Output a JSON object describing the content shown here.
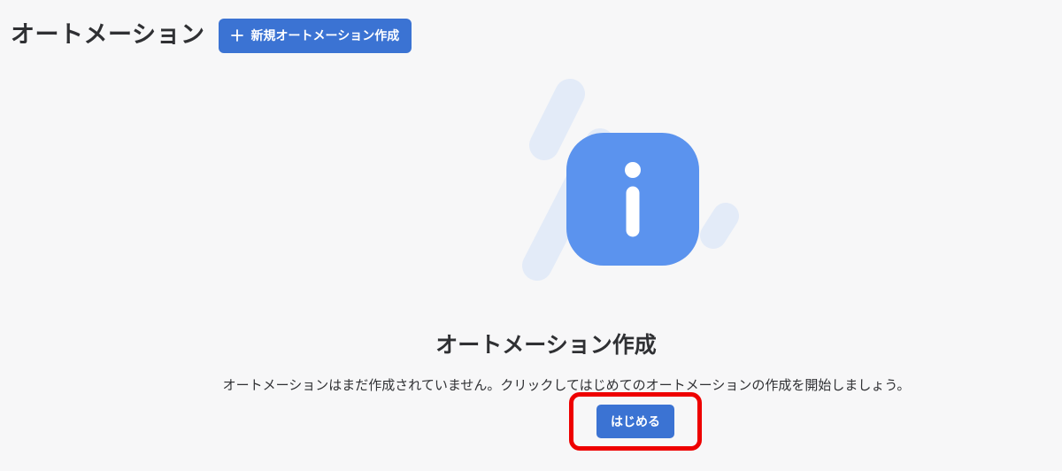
{
  "header": {
    "title": "オートメーション",
    "new_button_label": "新規オートメーション作成"
  },
  "empty_state": {
    "title": "オートメーション作成",
    "description": "オートメーションはまだ作成されていません。クリックしてはじめてのオートメーションの作成を開始しましょう。",
    "start_button_label": "はじめる"
  },
  "icons": {
    "new_button_icon": "plus-icon",
    "illustration_icon": "info-icon"
  },
  "colors": {
    "accent": "#3b73d3",
    "illustration_primary": "#5b93ee",
    "illustration_secondary": "#e3ebf8",
    "highlight_box": "#ee0000"
  }
}
